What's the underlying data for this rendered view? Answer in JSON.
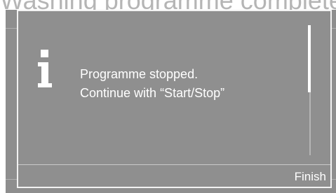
{
  "background": {
    "top_text": "Washing programme complete"
  },
  "dialog": {
    "icon": "info-icon",
    "message_line1": "Programme stopped.",
    "message_line2": "Continue with “Start/Stop”",
    "finish_label": "Finish"
  },
  "colors": {
    "panel": "#8f8f8f",
    "text": "#ffffff",
    "border": "#f2f2f2"
  }
}
